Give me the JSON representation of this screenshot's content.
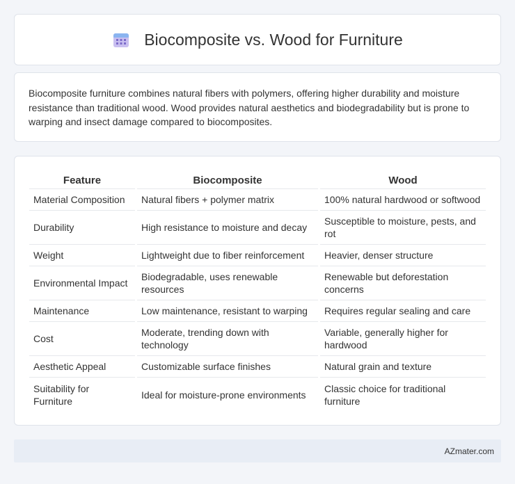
{
  "header": {
    "title": "Biocomposite vs. Wood for Furniture",
    "icon": "calendar-icon",
    "icon_colors": {
      "top": "#e86c6c",
      "body": "#b8a9e8",
      "dots": "#7c6bc9"
    }
  },
  "summary": {
    "text": "Biocomposite furniture combines natural fibers with polymers, offering higher durability and moisture resistance than traditional wood. Wood provides natural aesthetics and biodegradability but is prone to warping and insect damage compared to biocomposites."
  },
  "table": {
    "headers": [
      "Feature",
      "Biocomposite",
      "Wood"
    ],
    "rows": [
      {
        "feature": "Material Composition",
        "biocomposite": "Natural fibers + polymer matrix",
        "wood": "100% natural hardwood or softwood"
      },
      {
        "feature": "Durability",
        "biocomposite": "High resistance to moisture and decay",
        "wood": "Susceptible to moisture, pests, and rot"
      },
      {
        "feature": "Weight",
        "biocomposite": "Lightweight due to fiber reinforcement",
        "wood": "Heavier, denser structure"
      },
      {
        "feature": "Environmental Impact",
        "biocomposite": "Biodegradable, uses renewable resources",
        "wood": "Renewable but deforestation concerns"
      },
      {
        "feature": "Maintenance",
        "biocomposite": "Low maintenance, resistant to warping",
        "wood": "Requires regular sealing and care"
      },
      {
        "feature": "Cost",
        "biocomposite": "Moderate, trending down with technology",
        "wood": "Variable, generally higher for hardwood"
      },
      {
        "feature": "Aesthetic Appeal",
        "biocomposite": "Customizable surface finishes",
        "wood": "Natural grain and texture"
      },
      {
        "feature": "Suitability for Furniture",
        "biocomposite": "Ideal for moisture-prone environments",
        "wood": "Classic choice for traditional furniture"
      }
    ]
  },
  "footer": {
    "text": "AZmater.com"
  }
}
